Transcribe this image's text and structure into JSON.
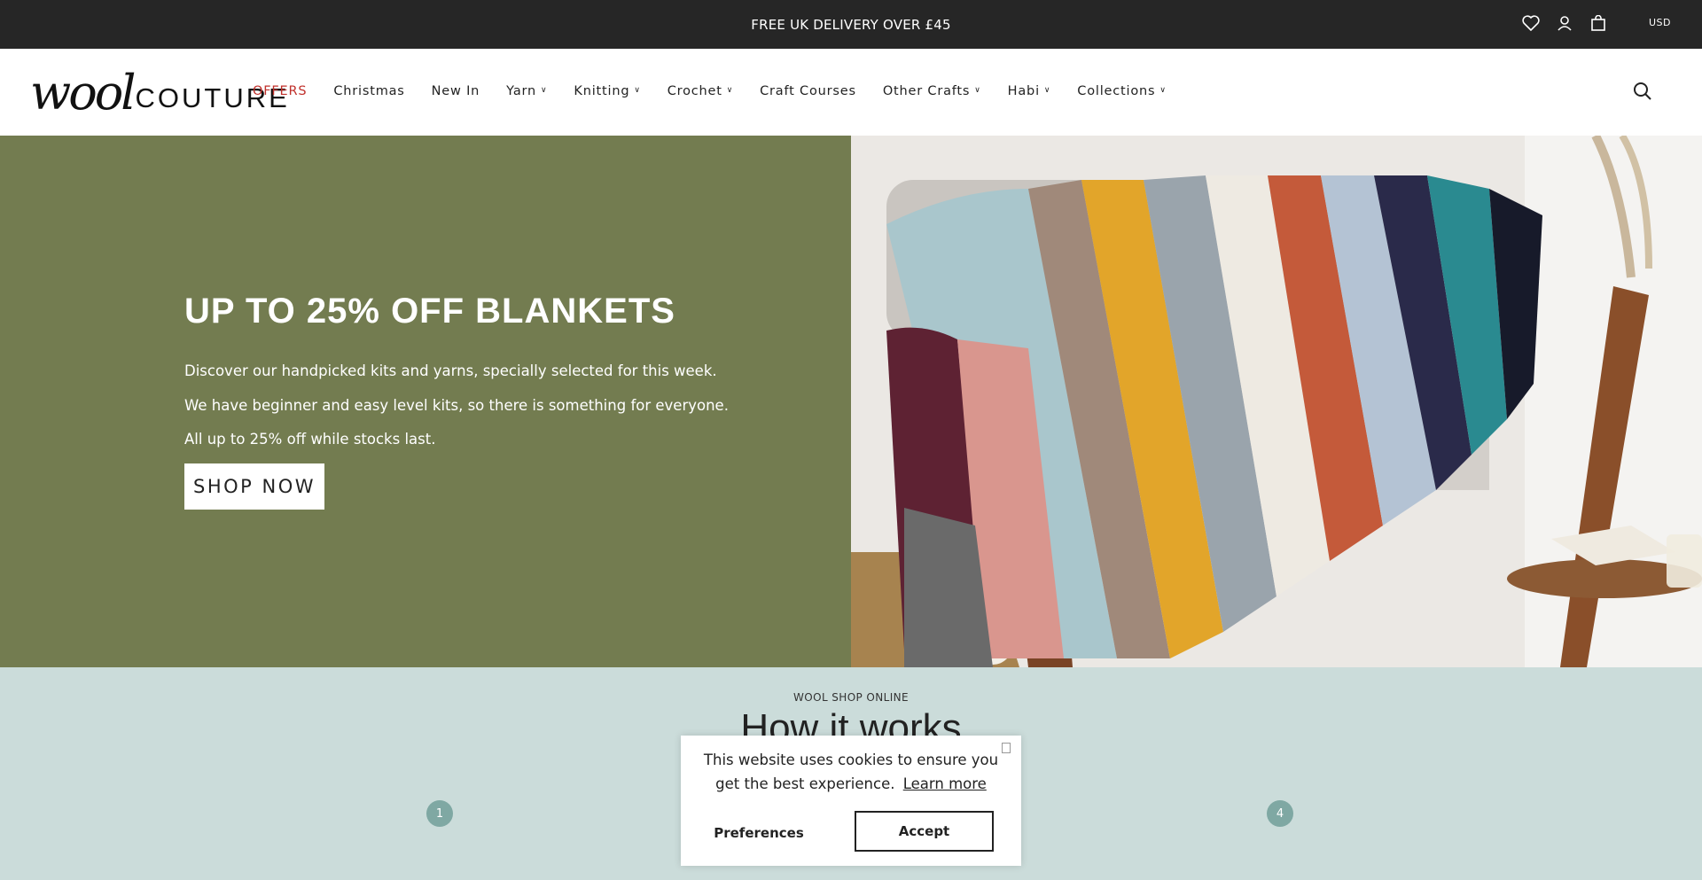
{
  "announcement": {
    "text": "FREE UK DELIVERY OVER £45",
    "currency": "USD",
    "icons": [
      "heart-icon",
      "account-icon",
      "bag-icon"
    ]
  },
  "header": {
    "logo_script": "wool",
    "logo_caps": "COUTURE",
    "nav": [
      {
        "label": "OFFERS",
        "has_dropdown": false
      },
      {
        "label": "Christmas",
        "has_dropdown": false
      },
      {
        "label": "New In",
        "has_dropdown": false
      },
      {
        "label": "Yarn",
        "has_dropdown": true
      },
      {
        "label": "Knitting",
        "has_dropdown": true
      },
      {
        "label": "Crochet",
        "has_dropdown": true
      },
      {
        "label": "Craft Courses",
        "has_dropdown": false
      },
      {
        "label": "Other Crafts",
        "has_dropdown": true
      },
      {
        "label": "Habi",
        "has_dropdown": true
      },
      {
        "label": "Collections",
        "has_dropdown": true
      }
    ],
    "search_icon": "search-icon"
  },
  "hero": {
    "title": "UP TO 25% OFF BLANKETS",
    "lines": [
      "Discover our handpicked kits and yarns, specially selected for this week.",
      "We have beginner and easy level kits, so there is something for everyone.",
      "All up to 25% off while stocks last."
    ],
    "button": "SHOP NOW",
    "left_color": "#737c50"
  },
  "how": {
    "eyebrow": "WOOL SHOP ONLINE",
    "title": "How it works",
    "steps": [
      "1",
      "4"
    ]
  },
  "cookie": {
    "message": "This website uses cookies to ensure you get the best experience.",
    "learn_more": "Learn more",
    "preferences": "Preferences",
    "accept": "Accept"
  }
}
